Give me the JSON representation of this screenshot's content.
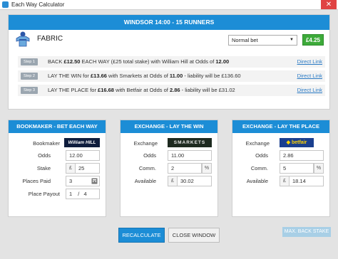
{
  "window": {
    "title": "Each Way Calculator",
    "close_glyph": "✕"
  },
  "race": {
    "header": "WINDSOR 14:00  -  15 RUNNERS",
    "horse": "FABRIC"
  },
  "bet_type": {
    "selected": "Normal bet"
  },
  "price_badge": "£4.25",
  "steps": [
    {
      "label": "Step 1",
      "pre": "BACK ",
      "amount": "£12.50",
      "mid": " EACH WAY (£25 total stake) with William Hill at Odds of ",
      "odds": "12.00",
      "post": "",
      "link": "Direct Link"
    },
    {
      "label": "Step 2",
      "pre": "LAY THE WIN for ",
      "amount": "£13.66",
      "mid": " with Smarkets at Odds of ",
      "odds": "11.00",
      "post": " - liability will be £136.60",
      "link": "Direct Link"
    },
    {
      "label": "Step 3",
      "pre": "LAY THE PLACE for ",
      "amount": "£16.68",
      "mid": " with Betfair at Odds of ",
      "odds": "2.86",
      "post": " - liability will be £31.02",
      "link": "Direct Link"
    }
  ],
  "bookmaker": {
    "header": "BOOKMAKER - BET EACH WAY",
    "bookmaker_label": "Bookmaker",
    "logo_text": "William HILL",
    "odds_label": "Odds",
    "odds": "12.00",
    "stake_label": "Stake",
    "stake_prefix": "£",
    "stake": "25",
    "places_label": "Places Paid",
    "places": "3",
    "payout_label": "Place Payout",
    "payout_num": "1",
    "payout_sep": "/",
    "payout_den": "4"
  },
  "lay_win": {
    "header": "EXCHANGE - LAY THE WIN",
    "exchange_label": "Exchange",
    "logo_text": "SMARKETS",
    "odds_label": "Odds",
    "odds": "11.00",
    "comm_label": "Comm.",
    "comm": "2",
    "comm_suffix": "%",
    "available_label": "Available",
    "available_prefix": "£",
    "available": "30.02"
  },
  "lay_place": {
    "header": "EXCHANGE - LAY THE PLACE",
    "exchange_label": "Exchange",
    "logo_text": "betfair",
    "odds_label": "Odds",
    "odds": "2.86",
    "comm_label": "Comm.",
    "comm": "5",
    "comm_suffix": "%",
    "available_label": "Available",
    "available_prefix": "£",
    "available": "18.14"
  },
  "buttons": {
    "recalculate": "RECALCULATE",
    "close_window": "CLOSE WINDOW",
    "max_back_stake": "MAX. BACK STAKE"
  },
  "colors": {
    "accent": "#1c8dd6",
    "badge_green": "#3daa3a",
    "link": "#2a7ac4"
  }
}
